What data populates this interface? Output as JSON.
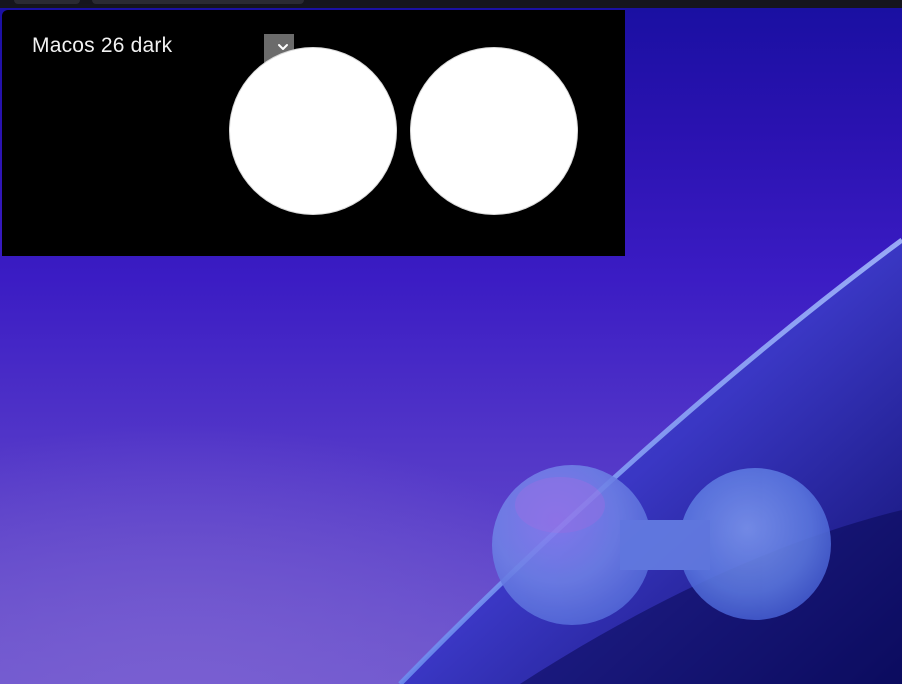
{
  "theme_selector": {
    "selected_label": "Macos 26 dark"
  },
  "icons": {
    "chevron": "chevron-down-icon"
  },
  "colors": {
    "panel_background": "#000000",
    "wallpaper_top": "#1a10a2",
    "wallpaper_bottom": "#6c56cc",
    "preview_circle": "#ffffff"
  }
}
